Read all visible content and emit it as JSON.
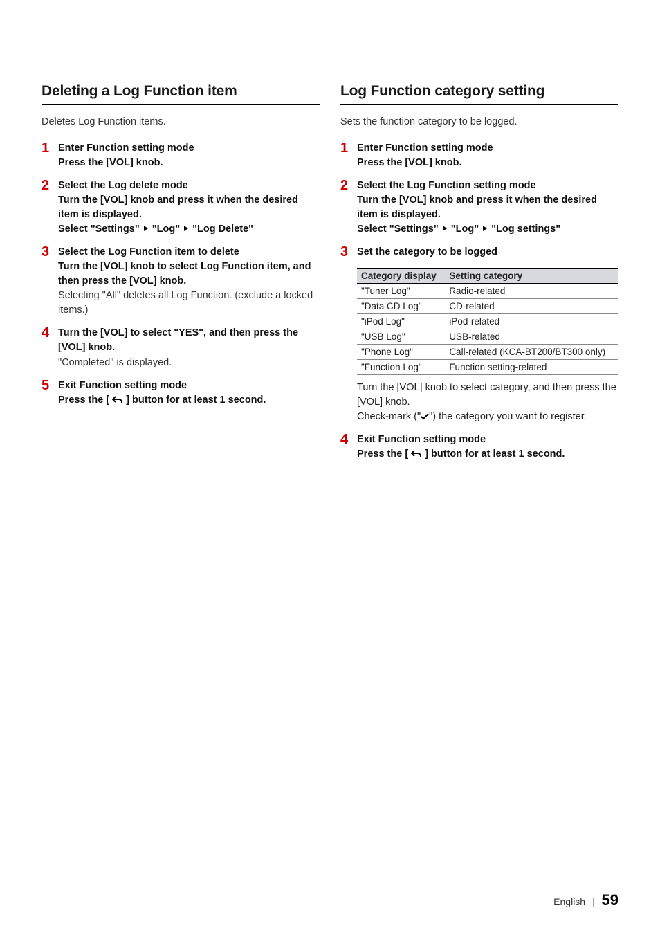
{
  "left": {
    "title": "Deleting a Log Function item",
    "intro": "Deletes Log Function items.",
    "steps": [
      {
        "num": "1",
        "lines": [
          {
            "bold": true,
            "parts": [
              "Enter Function setting mode"
            ]
          },
          {
            "bold": true,
            "parts": [
              "Press the [VOL] knob."
            ]
          }
        ]
      },
      {
        "num": "2",
        "lines": [
          {
            "bold": true,
            "parts": [
              "Select the Log delete mode"
            ]
          },
          {
            "bold": true,
            "parts": [
              "Turn the [VOL] knob and press it when the desired item is displayed."
            ]
          },
          {
            "bold": true,
            "parts": [
              "Select \"Settings\" ",
              {
                "icon": "arrow"
              },
              " \"Log\" ",
              {
                "icon": "arrow"
              },
              " \"Log Delete\""
            ]
          }
        ]
      },
      {
        "num": "3",
        "lines": [
          {
            "bold": true,
            "parts": [
              "Select the Log Function item to delete"
            ]
          },
          {
            "bold": true,
            "parts": [
              "Turn the [VOL] knob to select Log Function item, and then press the [VOL] knob."
            ]
          },
          {
            "bold": false,
            "parts": [
              "Selecting \"All\" deletes all Log Function. (exclude a locked items.)"
            ]
          }
        ]
      },
      {
        "num": "4",
        "lines": [
          {
            "bold": true,
            "parts": [
              "Turn the [VOL] to select \"YES\", and then press the [VOL] knob."
            ]
          },
          {
            "bold": false,
            "parts": [
              "\"Completed\" is displayed."
            ]
          }
        ]
      },
      {
        "num": "5",
        "lines": [
          {
            "bold": true,
            "parts": [
              "Exit Function setting mode"
            ]
          },
          {
            "bold": true,
            "parts": [
              "Press the [ ",
              {
                "icon": "back"
              },
              " ] button for at least 1 second."
            ]
          }
        ]
      }
    ]
  },
  "right": {
    "title": "Log Function category setting",
    "intro": "Sets the function category to be logged.",
    "steps": [
      {
        "num": "1",
        "lines": [
          {
            "bold": true,
            "parts": [
              "Enter Function setting mode"
            ]
          },
          {
            "bold": true,
            "parts": [
              "Press the [VOL] knob."
            ]
          }
        ]
      },
      {
        "num": "2",
        "lines": [
          {
            "bold": true,
            "parts": [
              "Select the Log Function setting mode"
            ]
          },
          {
            "bold": true,
            "parts": [
              "Turn the [VOL] knob and press it when the desired item is displayed."
            ]
          },
          {
            "bold": true,
            "parts": [
              "Select \"Settings\" ",
              {
                "icon": "arrow"
              },
              " \"Log\" ",
              {
                "icon": "arrow"
              },
              " \"Log settings\""
            ]
          }
        ]
      },
      {
        "num": "3",
        "lines": [
          {
            "bold": true,
            "parts": [
              "Set the category to be logged"
            ]
          }
        ]
      }
    ],
    "table": {
      "headers": [
        "Category display",
        "Setting category"
      ],
      "rows": [
        [
          "\"Tuner Log\"",
          "Radio-related"
        ],
        [
          "\"Data CD Log\"",
          "CD-related"
        ],
        [
          "\"iPod Log\"",
          "iPod-related"
        ],
        [
          "\"USB Log\"",
          "USB-related"
        ],
        [
          "\"Phone Log\"",
          "Call-related (KCA-BT200/BT300 only)"
        ],
        [
          "\"Function Log\"",
          "Function setting-related"
        ]
      ]
    },
    "after_table_lines": [
      {
        "bold": true,
        "parts": [
          "Turn the [VOL] knob to select category, and then press the [VOL] knob."
        ]
      },
      {
        "bold": false,
        "parts": [
          "Check-mark (\"",
          {
            "icon": "check"
          },
          "\") the category you want to register."
        ]
      }
    ],
    "step4": {
      "num": "4",
      "lines": [
        {
          "bold": true,
          "parts": [
            "Exit Function setting mode"
          ]
        },
        {
          "bold": true,
          "parts": [
            "Press the [ ",
            {
              "icon": "back"
            },
            " ] button for at least 1 second."
          ]
        }
      ]
    }
  },
  "footer": {
    "lang": "English",
    "page": "59"
  }
}
